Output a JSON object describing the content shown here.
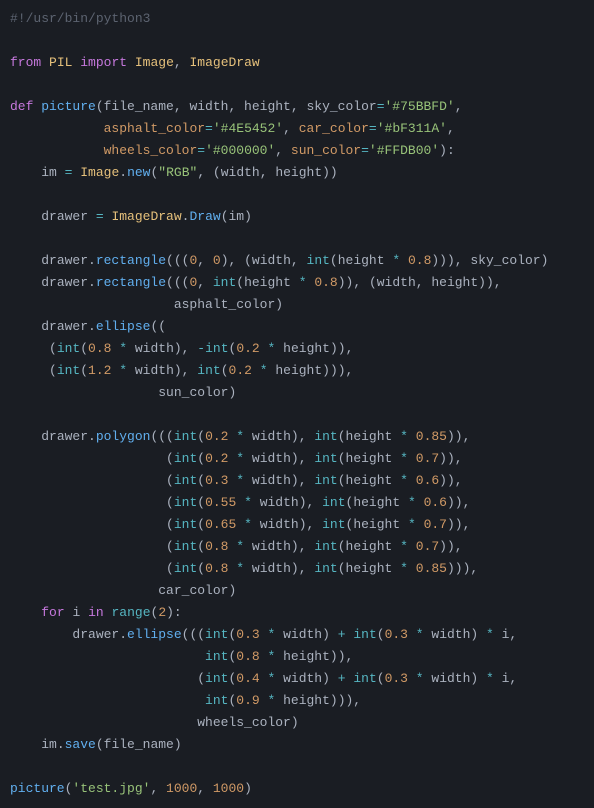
{
  "lines": {
    "l01_shebang": "#!/usr/bin/python3",
    "l02_from": "from",
    "l02_pil": "PIL",
    "l02_import": "import",
    "l02_image": "Image",
    "l02_comma": ", ",
    "l02_imagedraw": "ImageDraw",
    "l03_def": "def",
    "l03_fname": "picture",
    "l03_open": "(file_name, width, height, sky_color",
    "l03_eq": "=",
    "l03_sky": "'#75BBFD'",
    "l03_end": ",",
    "l04_asph_k": "asphalt_color",
    "l04_asph_v": "'#4E5452'",
    "l04_car_k": "car_color",
    "l04_car_v": "'#bF311A'",
    "l05_wh_k": "wheels_color",
    "l05_wh_v": "'#000000'",
    "l05_sun_k": "sun_color",
    "l05_sun_v": "'#FFDB00'",
    "l06_im": "im ",
    "l06_image": "Image",
    "l06_new": "new",
    "l06_rgb": "\"RGB\"",
    "l06_args": ", (width, height))",
    "l07_drawer": "drawer ",
    "l07_imagedraw": "ImageDraw",
    "l07_draw": "Draw",
    "l07_im": "(im)",
    "l08_rect": "rectangle",
    "l08_args": "(((",
    "l08_zero": "0",
    "l08_mid": ", (width, ",
    "l08_int": "int",
    "l08_h": "(height ",
    "l08_08": "0.8",
    "l08_end": "))), sky_color)",
    "l09_end": ")), (width, height)),",
    "l09_asph": "asphalt_color)",
    "l10_ellipse": "ellipse",
    "l10_open": "((",
    "l11_int": "int",
    "l11_08": "0.8",
    "l11_w": " width), ",
    "l11_02": "0.2",
    "l11_h": " height)),",
    "l12_12": "1.2",
    "l12_sun": "sun_color)",
    "l13_polygon": "polygon",
    "l13_02": "0.2",
    "l13_085": "0.85",
    "l13_07": "0.7",
    "l13_03": "0.3",
    "l13_06": "0.6",
    "l13_055": "0.55",
    "l13_065": "0.65",
    "l13_08": "0.8",
    "l13_car": "car_color)",
    "l14_for": "for",
    "l14_i": "i",
    "l14_in": "in",
    "l14_range": "range",
    "l14_2": "2",
    "l15_03": "0.3",
    "l15_08": "0.8",
    "l15_04": "0.4",
    "l15_09": "0.9",
    "l15_wh": "wheels_color)",
    "l16_save": "save",
    "l16_fn": "(file_name)",
    "l17_test": "'test.jpg'",
    "l17_1000a": "1000",
    "l17_1000b": "1000",
    "word_drawer": "drawer.",
    "word_int": "int",
    "word_width": " width), ",
    "word_height": " height)),",
    "word_height2": " height))),",
    "op_star": "*",
    "op_neg": "-",
    "op_star_sp": " * ",
    "paren_open": "(",
    "paren_close": ")"
  }
}
